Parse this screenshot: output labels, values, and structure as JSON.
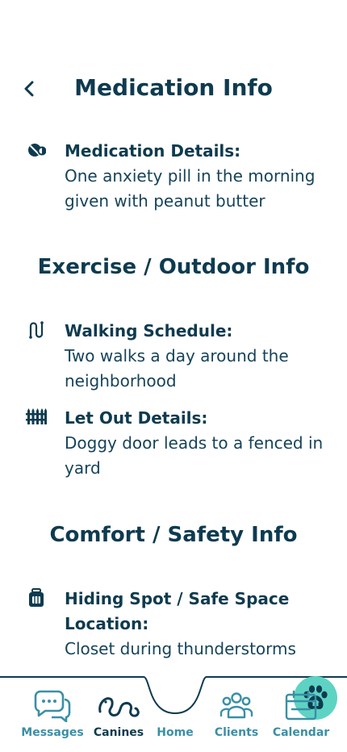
{
  "header": {
    "title": "Medication Info",
    "back_icon": "chevron-left-icon"
  },
  "medication": {
    "icon": "pills-icon",
    "label": "Medication Details:",
    "value": "One anxiety pill in the morning given with peanut butter"
  },
  "exercise": {
    "section_title": "Exercise / Outdoor Info",
    "walking": {
      "icon": "route-icon",
      "label": "Walking Schedule:",
      "value": "Two walks a day around the neighborhood"
    },
    "let_out": {
      "icon": "fence-icon",
      "label": "Let Out Details:",
      "value": "Doggy door leads to a fenced in yard"
    }
  },
  "comfort": {
    "section_title": "Comfort / Safety Info",
    "hiding": {
      "icon": "kennel-icon",
      "label": "Hiding Spot / Safe Space Location:",
      "value": "Closet during thunderstorms"
    }
  },
  "nav": {
    "messages": "Messages",
    "canines": "Canines",
    "home": "Home",
    "clients": "Clients",
    "calendar": "Calendar"
  },
  "colors": {
    "primary": "#0e3b4f",
    "accent": "#3a8fa6",
    "home_bubble": "#5fd3c3"
  }
}
